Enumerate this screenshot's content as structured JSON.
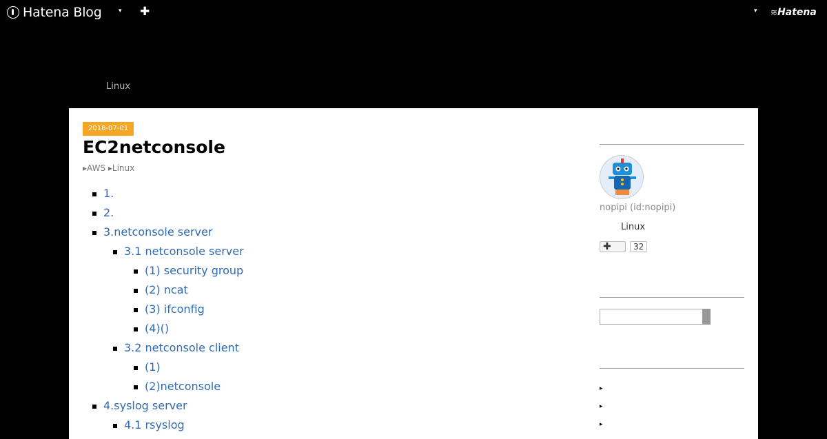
{
  "header": {
    "logo_text": "Hatena Blog",
    "logo_icon": "hatena-blog-icon",
    "caret": "▾",
    "plus": "✚",
    "hatena_text": "Hatena"
  },
  "blog": {
    "description": "Linux"
  },
  "entry": {
    "date": "2018-07-01",
    "title": "EC2netconsole",
    "categories": [
      "▸AWS",
      "▸Linux"
    ],
    "toc": [
      "1.",
      "2.",
      "3.netconsole server",
      "3.1 netconsole server",
      "(1) security group",
      "(2) ncat",
      "(3) ifconfig",
      "(4)()",
      "3.2 netconsole client",
      "(1)",
      "(2)netconsole",
      "4.syslog server",
      "4.1 rsyslog"
    ]
  },
  "sidebar": {
    "profile_id": "nopipi (id:nopipi)",
    "profile_desc": "Linux",
    "subscribe_label": "✚",
    "subscribe_count": "32",
    "search_placeholder": "",
    "archive_arrows": [
      "▸",
      "▸",
      "▸"
    ]
  },
  "colors": {
    "background": "#000000",
    "link": "#2f6bb2",
    "date_badge": "#f5a623"
  }
}
